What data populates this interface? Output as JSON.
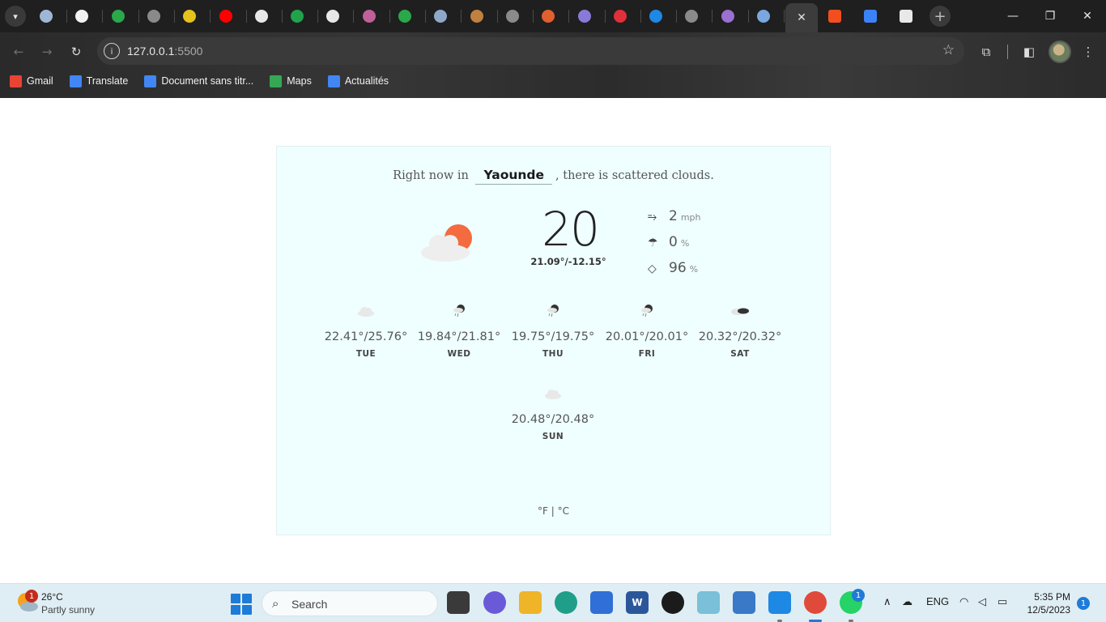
{
  "browser": {
    "tab_strip": {
      "tab_search_icon": "chevron-down",
      "favicons": [
        {
          "name": "tab-favicon-1",
          "color": "#9fb7d6"
        },
        {
          "name": "tab-favicon-2",
          "color": "#f2f2f2"
        },
        {
          "name": "tab-favicon-3",
          "color": "#2aa84a"
        },
        {
          "name": "tab-favicon-4",
          "color": "#8a8a8a"
        },
        {
          "name": "tab-favicon-5",
          "color": "#e6c21c"
        },
        {
          "name": "tab-favicon-youtube",
          "color": "#ff0000"
        },
        {
          "name": "tab-favicon-medium",
          "color": "#e8e8e8"
        },
        {
          "name": "tab-favicon-w",
          "color": "#20a34a"
        },
        {
          "name": "tab-favicon-9",
          "color": "#e8e8e8"
        },
        {
          "name": "tab-favicon-10",
          "color": "#c0609a"
        },
        {
          "name": "tab-favicon-11",
          "color": "#2aa84a"
        },
        {
          "name": "tab-favicon-12",
          "color": "#8fa8c8"
        },
        {
          "name": "tab-favicon-13",
          "color": "#c08040"
        },
        {
          "name": "tab-favicon-14",
          "color": "#8a8a8a"
        },
        {
          "name": "tab-favicon-15",
          "color": "#e06030"
        },
        {
          "name": "tab-favicon-16",
          "color": "#8a7ad8"
        },
        {
          "name": "tab-favicon-17",
          "color": "#e0303a"
        },
        {
          "name": "tab-favicon-18",
          "color": "#1e88e5"
        },
        {
          "name": "tab-favicon-19",
          "color": "#8a8a8a"
        },
        {
          "name": "tab-favicon-20",
          "color": "#9a70d0"
        },
        {
          "name": "tab-favicon-21",
          "color": "#7aa7e0"
        }
      ],
      "active_tab_close": "✕",
      "after_active": [
        {
          "name": "tab-favicon-figma",
          "color": "#f24e1e"
        },
        {
          "name": "tab-favicon-flag",
          "color": "#3b82f6"
        },
        {
          "name": "tab-favicon-codepen",
          "color": "#e8e8e8"
        }
      ],
      "new_tab": "+"
    },
    "window_controls": {
      "minimize": "—",
      "restore": "❐",
      "close": "✕"
    },
    "address": {
      "host": "127.0.0.1",
      "port": ":5500"
    },
    "bookmarks": [
      {
        "label": "Gmail",
        "color": "#ea4335"
      },
      {
        "label": "Translate",
        "color": "#4285f4"
      },
      {
        "label": "Document sans titr...",
        "color": "#4285f4"
      },
      {
        "label": "Maps",
        "color": "#34a853"
      },
      {
        "label": "Actualités",
        "color": "#4285f4"
      }
    ]
  },
  "weather": {
    "headline_prefix": "Right now in",
    "city": "Yaounde",
    "headline_suffix": ", there is scattered clouds.",
    "current_temp": "20",
    "temp_range": "21.09°/-12.15°",
    "stats": {
      "wind": {
        "value": "2",
        "unit": "mph",
        "icon": "wind-icon"
      },
      "precipitation": {
        "value": "0",
        "unit": "%",
        "icon": "umbrella-icon"
      },
      "humidity": {
        "value": "96",
        "unit": "%",
        "icon": "droplet-icon"
      }
    },
    "forecast": [
      {
        "day": "TUE",
        "range": "22.41°/25.76°",
        "icon": "cloud"
      },
      {
        "day": "WED",
        "range": "19.84°/21.81°",
        "icon": "rain"
      },
      {
        "day": "THU",
        "range": "19.75°/19.75°",
        "icon": "rain"
      },
      {
        "day": "FRI",
        "range": "20.01°/20.01°",
        "icon": "rain"
      },
      {
        "day": "SAT",
        "range": "20.32°/20.32°",
        "icon": "broken-clouds"
      },
      {
        "day": "SUN",
        "range": "20.48°/20.48°",
        "icon": "cloud"
      }
    ],
    "unit_toggle": "°F | °C"
  },
  "taskbar": {
    "weather_badge": "1",
    "weather_temp": "26°C",
    "weather_condition": "Partly sunny",
    "search_placeholder": "Search",
    "tray_language": "ENG",
    "time": "5:35 PM",
    "date": "12/5/2023",
    "notification_count": "1",
    "whatsapp_badge": "1"
  }
}
